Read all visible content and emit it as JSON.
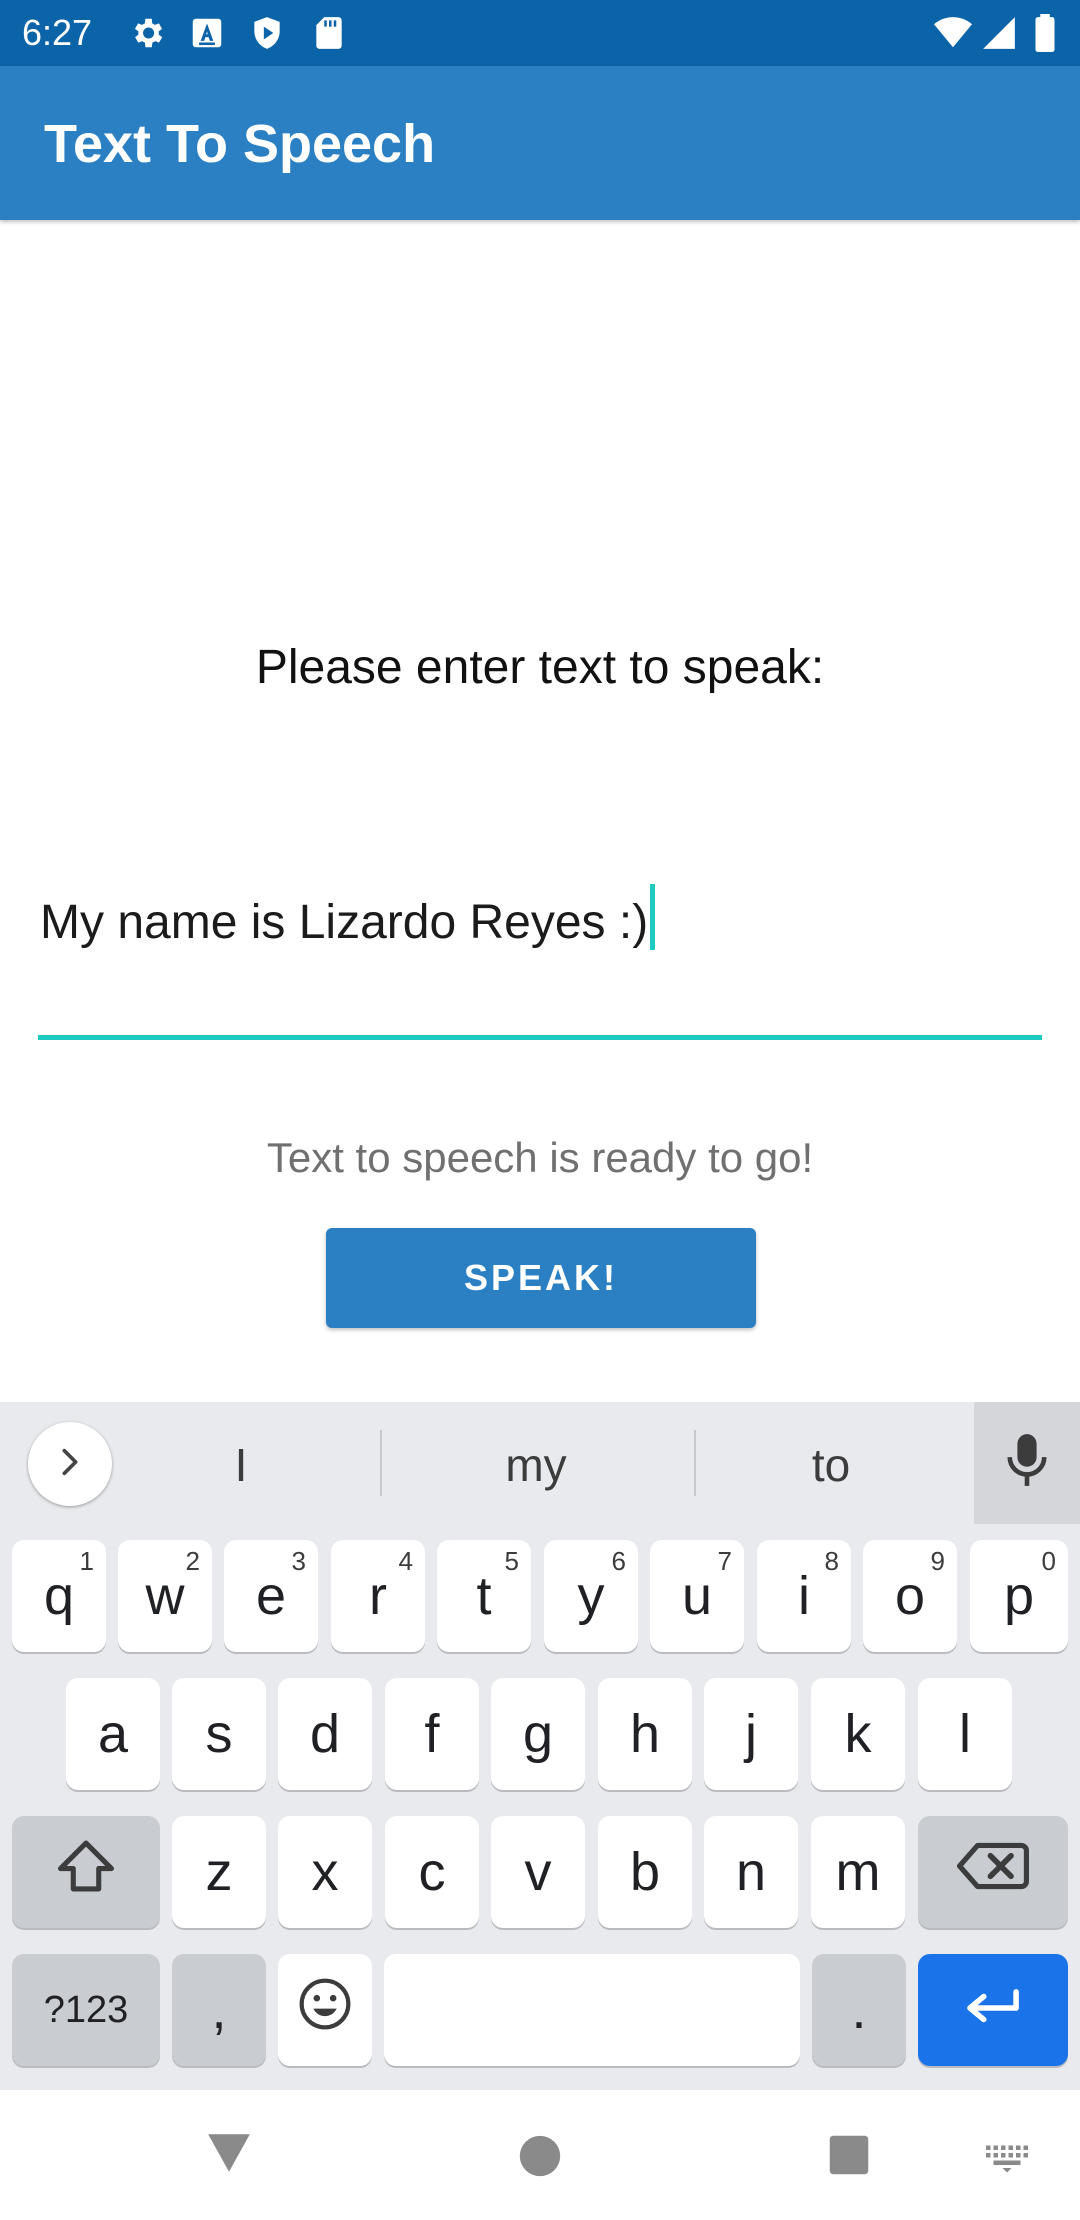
{
  "status_bar": {
    "time": "6:27",
    "left_icons": [
      "gear-icon",
      "accessibility-a-icon",
      "shield-play-icon",
      "sd-card-icon"
    ],
    "right_icons": [
      "wifi-icon",
      "signal-icon",
      "battery-icon"
    ]
  },
  "app_bar": {
    "title": "Text To Speech"
  },
  "main": {
    "prompt": "Please enter text to speak:",
    "input_value": "My name is Lizardo Reyes :)",
    "status": "Text to speech is ready to go!",
    "speak_label": "SPEAK!"
  },
  "keyboard": {
    "suggestions": [
      "I",
      "my",
      "to"
    ],
    "row1": [
      {
        "key": "q",
        "hint": "1"
      },
      {
        "key": "w",
        "hint": "2"
      },
      {
        "key": "e",
        "hint": "3"
      },
      {
        "key": "r",
        "hint": "4"
      },
      {
        "key": "t",
        "hint": "5"
      },
      {
        "key": "y",
        "hint": "6"
      },
      {
        "key": "u",
        "hint": "7"
      },
      {
        "key": "i",
        "hint": "8"
      },
      {
        "key": "o",
        "hint": "9"
      },
      {
        "key": "p",
        "hint": "0"
      }
    ],
    "row2": [
      "a",
      "s",
      "d",
      "f",
      "g",
      "h",
      "j",
      "k",
      "l"
    ],
    "row3": [
      "z",
      "x",
      "c",
      "v",
      "b",
      "n",
      "m"
    ],
    "symbols_label": "?123",
    "comma": ",",
    "period": "."
  },
  "colors": {
    "status_bar": "#0b63a8",
    "app_bar": "#2b80c3",
    "accent": "#1fcbbf",
    "enter_key": "#1a73e8"
  }
}
